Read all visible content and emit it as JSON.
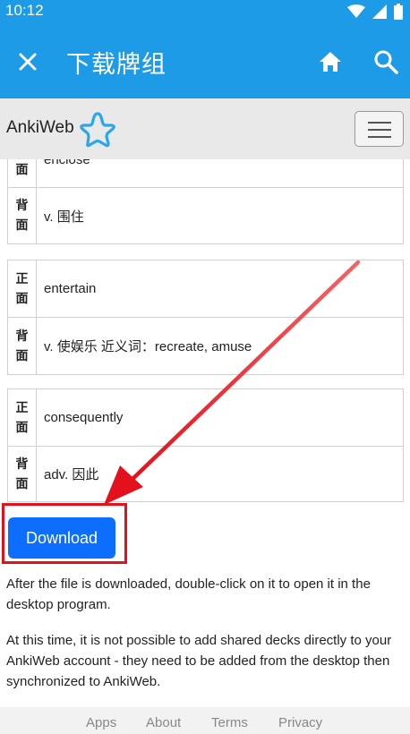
{
  "status": {
    "time": "10:12"
  },
  "app_bar": {
    "title": "下载牌组"
  },
  "web": {
    "brand": "AnkiWeb"
  },
  "cards": [
    {
      "front_label": "正\n面",
      "front_value": "enclose",
      "back_label": "背\n面",
      "back_value": "v. 围住"
    },
    {
      "front_label": "正\n面",
      "front_value": "entertain",
      "back_label": "背\n面",
      "back_value": "v. 使娱乐 近义词：recreate, amuse"
    },
    {
      "front_label": "正\n面",
      "front_value": "consequently",
      "back_label": "背\n面",
      "back_value": "adv. 因此"
    }
  ],
  "download": {
    "label": "Download"
  },
  "paragraphs": [
    "After the file is downloaded, double-click on it to open it in the desktop program.",
    "At this time, it is not possible to add shared decks directly to your AnkiWeb account - they need to be added from the desktop then synchronized to AnkiWeb."
  ],
  "footer": {
    "links": [
      "Apps",
      "About",
      "Terms",
      "Privacy"
    ]
  },
  "colors": {
    "primary": "#1e9be6",
    "button": "#0d6efd",
    "highlight": "#e2111b"
  }
}
